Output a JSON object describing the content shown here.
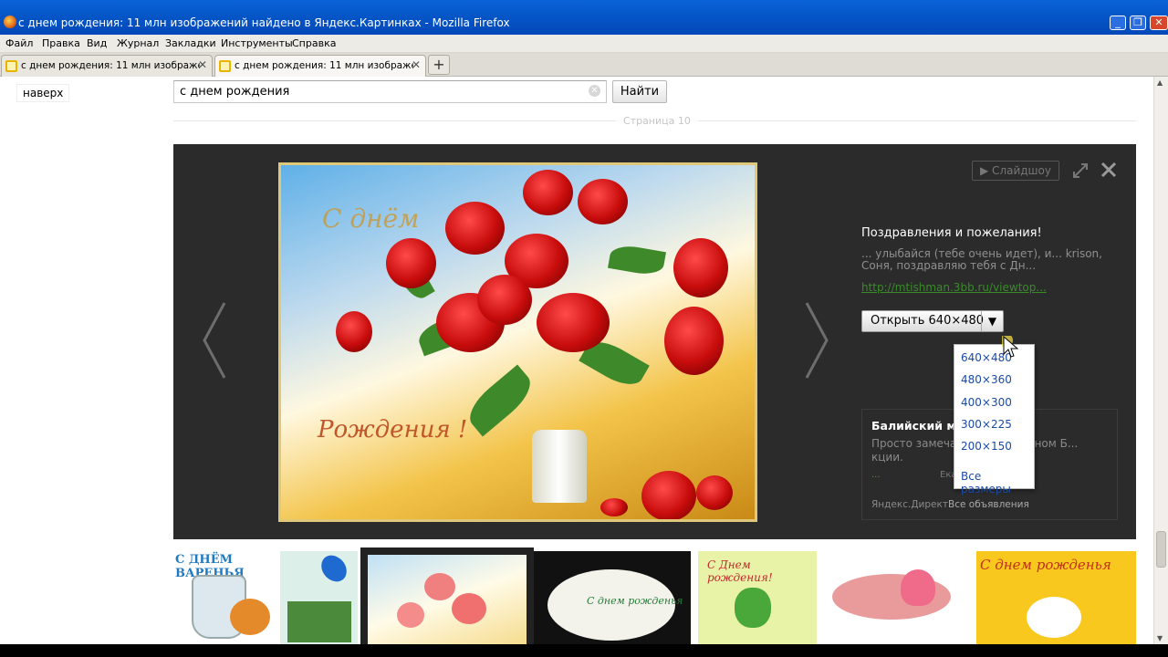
{
  "window": {
    "title": "с днем рождения: 11 млн изображений найдено в Яндекс.Картинках - Mozilla Firefox",
    "minimize": "_",
    "maximize": "❐",
    "close": "✕"
  },
  "menu": {
    "file": "Файл",
    "edit": "Правка",
    "view": "Вид",
    "history": "Журнал",
    "bookmarks": "Закладки",
    "tools": "Инструменты",
    "help": "Справка"
  },
  "tabs": [
    {
      "label": "с днем рождения: 11 млн изображений ...",
      "close": "✕"
    },
    {
      "label": "с днем рождения: 11 млн изображений ...",
      "close": "✕"
    }
  ],
  "new_tab": "+",
  "header": {
    "top_link": "наверх",
    "search_value": "с днем рождения",
    "find_button": "Найти",
    "page_number": "Страница 10"
  },
  "viewer": {
    "slideshow": "▶ Слайдшоу",
    "info_title": "Поздравления и пожелания!",
    "info_desc": "... улыбайся (тебе очень идет), и... krison, Соня, поздравляю тебя с Дн...",
    "info_link": "http://mtishman.3bb.ru/viewtop...",
    "open_button": "Открыть 640×480",
    "open_arrow": "▼",
    "image_text_top": "С днём",
    "image_text_bottom": "Рождения !"
  },
  "dropdown": {
    "options": [
      "640×480",
      "480×360",
      "400×300",
      "300×225",
      "200×150"
    ],
    "all_sizes": "Все размеры"
  },
  "ad": {
    "title": "Балийский ма... за 2200.",
    "text": "Просто замечат... в уникальном Б... кции.",
    "meta": "...",
    "meta2": "Екатерин...",
    "footer_direct": "Яндекс.Директ",
    "footer_all": "Все объявления"
  },
  "thumbnails": {
    "t1": "С ДНЁМ ВАРЕНЬЯ",
    "t5": "С Днем рождения!",
    "t7": "С днем рожденья",
    "t4": "С днем рожденья"
  },
  "scroll": {
    "up": "▲",
    "down": "▼"
  }
}
